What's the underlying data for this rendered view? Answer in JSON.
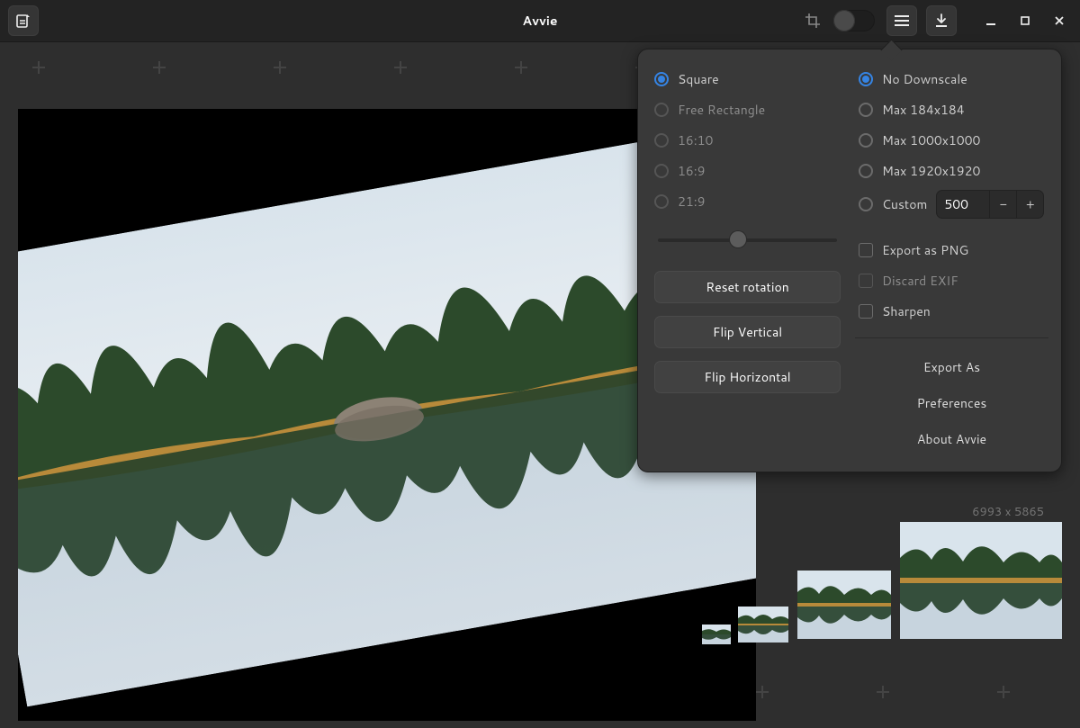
{
  "header": {
    "title": "Avvie"
  },
  "popover": {
    "aspect": {
      "options": [
        "Square",
        "Free Rectangle",
        "16:10",
        "16:9",
        "21:9"
      ],
      "selected": 0
    },
    "rotationSliderPct": 40,
    "resetRotation": "Reset rotation",
    "flipVertical": "Flip Vertical",
    "flipHorizontal": "Flip Horizontal",
    "downscale": {
      "options": [
        "No Downscale",
        "Max 184x184",
        "Max 1000x1000",
        "Max 1920x1920",
        "Custom"
      ],
      "selected": 0,
      "customValue": "500"
    },
    "exportPng": "Export as PNG",
    "discardExif": "Discard EXIF",
    "sharpen": "Sharpen",
    "menu": {
      "exportAs": "Export As",
      "preferences": "Preferences",
      "about": "About Avvie"
    }
  },
  "thumbnails": {
    "dimensions": "6993 x 5865"
  }
}
